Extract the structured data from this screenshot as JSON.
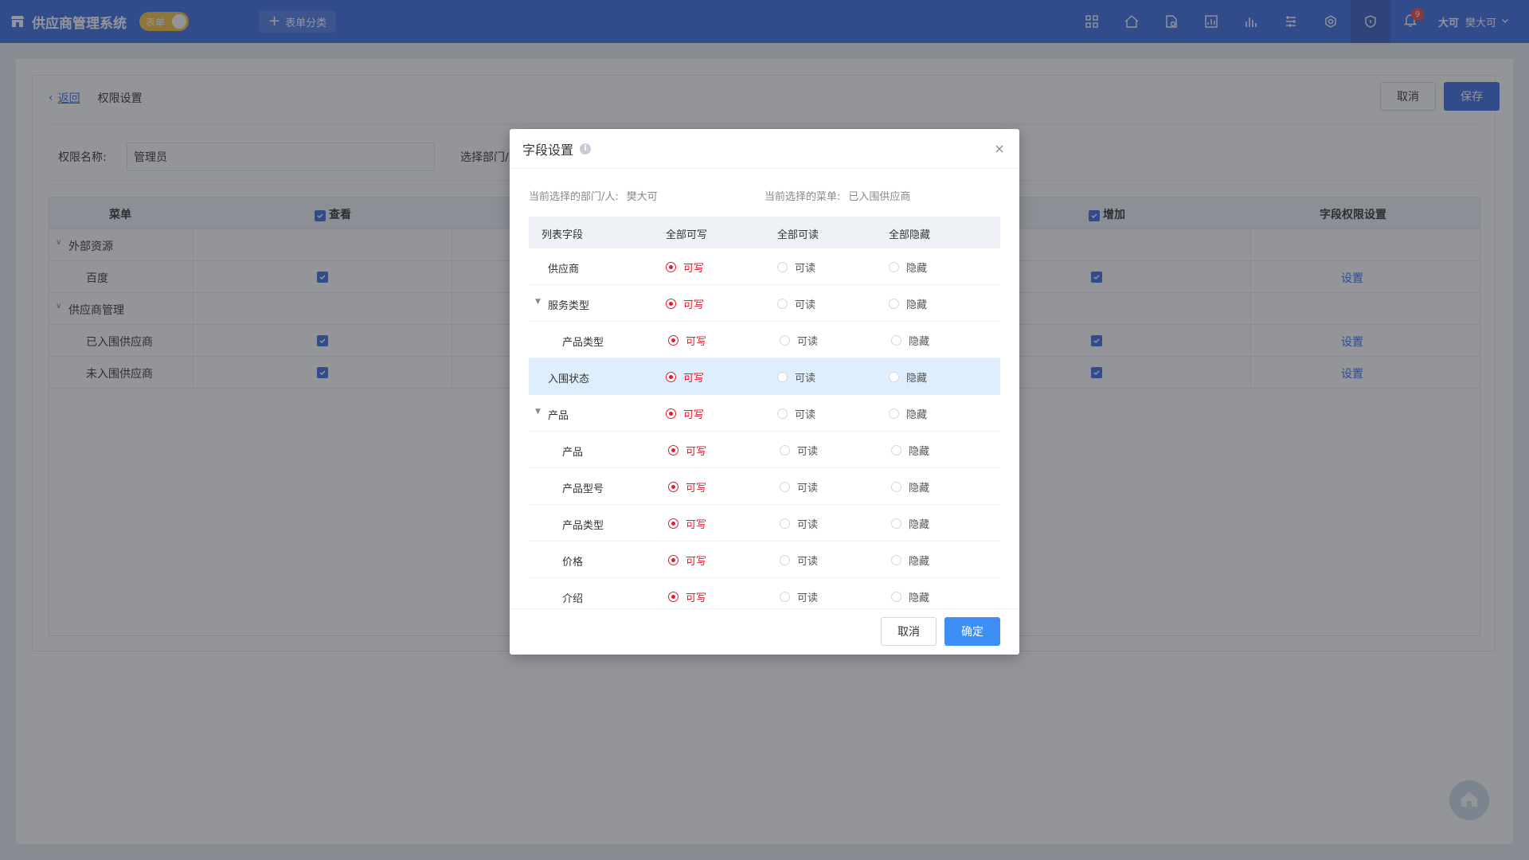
{
  "app": {
    "title": "供应商管理系统",
    "mode_toggle_label": "表单",
    "form_category_label": "表单分类",
    "notification_count": "9",
    "user_short": "大可",
    "user_name": "樊大可"
  },
  "page": {
    "back_label": "返回",
    "breadcrumb_current": "权限设置",
    "cancel_label": "取消",
    "save_label": "保存",
    "permission_name_label": "权限名称:",
    "permission_name_value": "管理员",
    "select_dept_label": "选择部门/人",
    "table": {
      "headers": [
        "菜单",
        "查看",
        "增加",
        "字段权限设置"
      ],
      "groups": [
        {
          "label": "外部资源",
          "items": [
            {
              "label": "百度",
              "action": "设置"
            }
          ]
        },
        {
          "label": "供应商管理",
          "items": [
            {
              "label": "已入围供应商",
              "action": "设置"
            },
            {
              "label": "未入围供应商",
              "action": "设置"
            }
          ]
        }
      ]
    }
  },
  "modal": {
    "title": "字段设置",
    "current_dept_label": "当前选择的部门/人:",
    "current_dept_value": "樊大可",
    "current_menu_label": "当前选择的菜单:",
    "current_menu_value": "已入围供应商",
    "headers": {
      "field": "列表字段",
      "all_write": "全部可写",
      "all_read": "全部可读",
      "all_hide": "全部隐藏"
    },
    "option_labels": {
      "write": "可写",
      "read": "可读",
      "hide": "隐藏"
    },
    "rows": [
      {
        "name": "供应商",
        "level": 0,
        "selected": "write"
      },
      {
        "name": "服务类型",
        "level": 0,
        "expandable": true,
        "selected": "write"
      },
      {
        "name": "产品类型",
        "level": 1,
        "selected": "write"
      },
      {
        "name": "入围状态",
        "level": 0,
        "selected": "write",
        "highlighted": true
      },
      {
        "name": "产品",
        "level": 0,
        "expandable": true,
        "selected": "write"
      },
      {
        "name": "产品",
        "level": 1,
        "selected": "write"
      },
      {
        "name": "产品型号",
        "level": 1,
        "selected": "write"
      },
      {
        "name": "产品类型",
        "level": 1,
        "selected": "write"
      },
      {
        "name": "价格",
        "level": 1,
        "selected": "write"
      },
      {
        "name": "介绍",
        "level": 1,
        "selected": "write"
      }
    ],
    "cancel_label": "取消",
    "confirm_label": "确定"
  },
  "colors": {
    "nav_bg": "#3d6ce3",
    "primary": "#3d6ce3",
    "confirm": "#3d8ff5",
    "radio_selected": "#e8192c",
    "highlight_row": "#deeefc",
    "toggle": "#f3c13a"
  },
  "icons": [
    "store-icon",
    "apps-icon",
    "home-icon",
    "document-settings-icon",
    "chart-icon",
    "bars-icon",
    "list-icon",
    "gear-icon",
    "shield-icon",
    "bell-icon",
    "chevron-down-icon",
    "close-icon",
    "info-icon"
  ]
}
